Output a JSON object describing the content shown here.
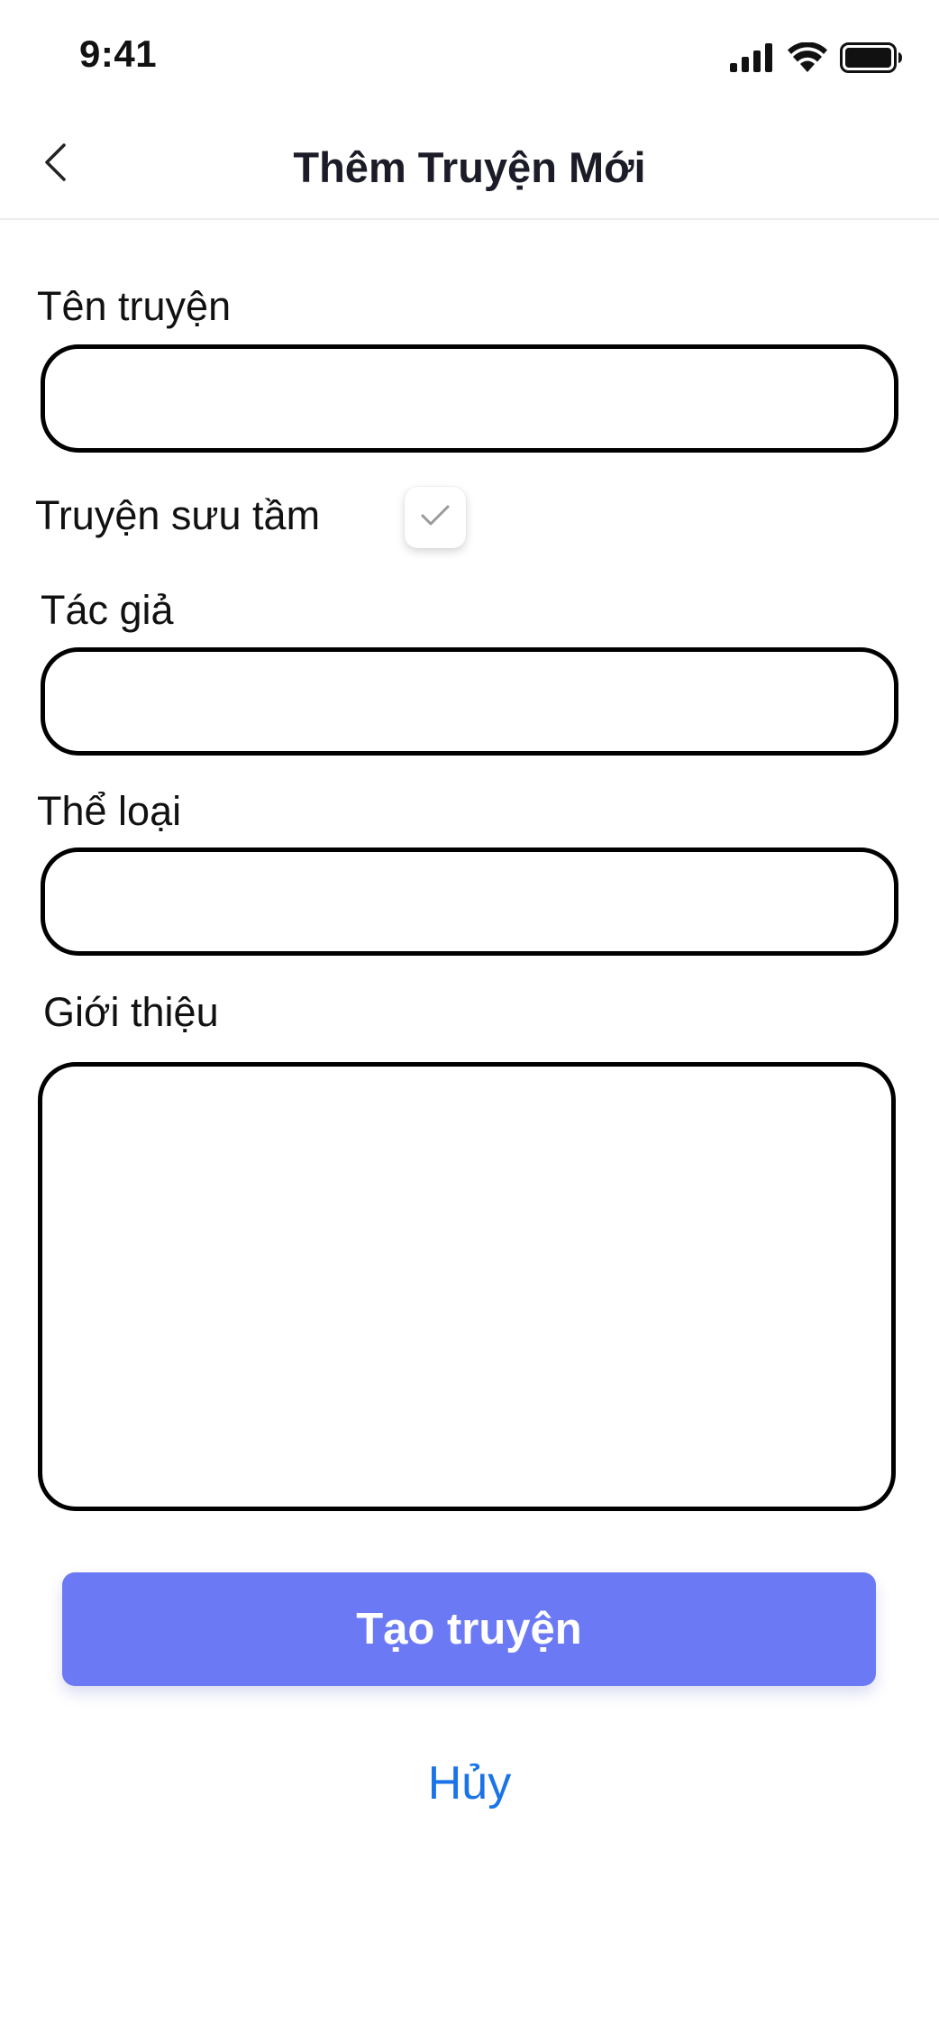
{
  "status_bar": {
    "time": "9:41",
    "icons": [
      "signal-icon",
      "wifi-icon",
      "battery-icon"
    ]
  },
  "nav": {
    "back_icon": "chevron-left-icon",
    "title": "Thêm Truyện Mới"
  },
  "form": {
    "title_field": {
      "label": "Tên truyện",
      "value": "",
      "placeholder": ""
    },
    "collected": {
      "label": "Truyện sưu tầm",
      "checked": false
    },
    "author_field": {
      "label": "Tác giả",
      "value": "",
      "placeholder": ""
    },
    "genre_field": {
      "label": "Thể loại",
      "value": "",
      "placeholder": ""
    },
    "intro_field": {
      "label": "Giới thiệu",
      "value": "",
      "placeholder": ""
    }
  },
  "actions": {
    "create_label": "Tạo truyện",
    "cancel_label": "Hủy"
  },
  "colors": {
    "primary": "#6b79f5",
    "link": "#1a73e8",
    "check": "#9a9a9a"
  }
}
